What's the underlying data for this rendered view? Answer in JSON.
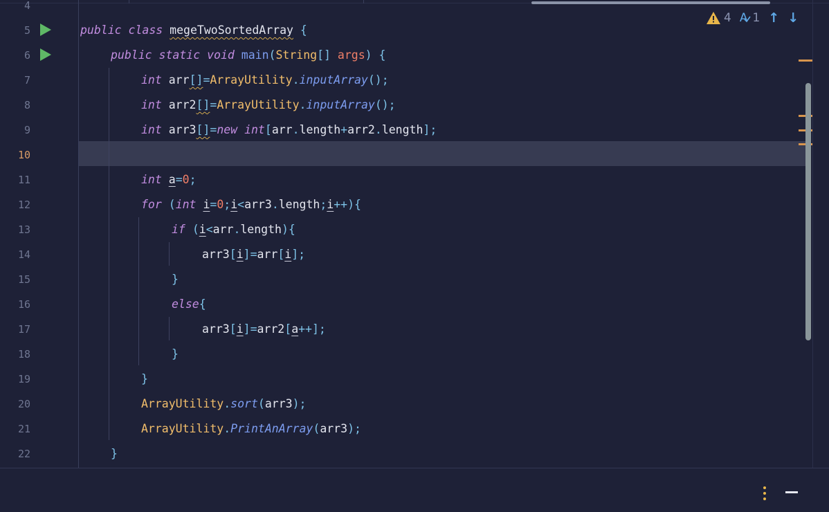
{
  "editor": {
    "lines": [
      {
        "n": "4"
      },
      {
        "n": "5"
      },
      {
        "n": "6"
      },
      {
        "n": "7"
      },
      {
        "n": "8"
      },
      {
        "n": "9"
      },
      {
        "n": "10"
      },
      {
        "n": "11"
      },
      {
        "n": "12"
      },
      {
        "n": "13"
      },
      {
        "n": "14"
      },
      {
        "n": "15"
      },
      {
        "n": "16"
      },
      {
        "n": "17"
      },
      {
        "n": "18"
      },
      {
        "n": "19"
      },
      {
        "n": "20"
      },
      {
        "n": "21"
      },
      {
        "n": "22"
      }
    ],
    "current_line": "10",
    "tokens": {
      "public": "public",
      "class": "class",
      "class_name": "megeTwoSortedArray",
      "lbrace": " {",
      "static": "static",
      "void": "void",
      "main": "main",
      "string": "String",
      "brackets": "[]",
      "args": "args",
      "rparen_brace": ") {",
      "int": "int",
      "arr": "arr",
      "arr2": "arr2",
      "arr3": "arr3",
      "array_utility": "ArrayUtility",
      "input_array": "inputArray",
      "call_end": "();",
      "new": "new",
      "length": "length",
      "a": "a",
      "zero": "0",
      "semi": ";",
      "for": "for",
      "i": "i",
      "lt": "<",
      "inc": "++",
      "if": "if",
      "else": "else",
      "rbrace": "}",
      "sort": "sort",
      "print_an_array": "PrintAnArray"
    }
  },
  "inspections": {
    "warnings_count": "4",
    "typos_count": "1",
    "warning_icon": "warning-triangle-icon",
    "typo_icon": "spellcheck-icon",
    "prev_icon": "arrow-up-icon",
    "next_icon": "arrow-down-icon",
    "typo_glyph": "A",
    "up_glyph": "↑",
    "down_glyph": "↓"
  },
  "colors": {
    "background": "#1e2137",
    "keyword": "#c28de0",
    "class": "#f2be6b",
    "method": "#7d9df0",
    "number": "#f07f68",
    "run": "#5fb866",
    "warning": "#e8b64a"
  }
}
